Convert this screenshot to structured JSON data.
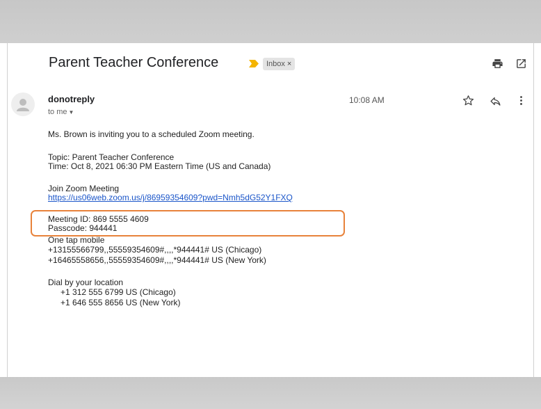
{
  "email": {
    "subject": "Parent Teacher Conference",
    "label_chip": "Inbox",
    "label_chip_close": "×",
    "sender": "donotreply",
    "recipient": "to me",
    "time": "10:08 AM",
    "body": {
      "invite_line": "Ms. Brown is inviting you to a scheduled Zoom meeting.",
      "topic": "Topic: Parent Teacher Conference",
      "time_line": "Time: Oct 8, 2021 06:30 PM Eastern Time (US and Canada)",
      "join_heading": "Join Zoom Meeting",
      "join_link": "https://us06web.zoom.us/j/86959354609?pwd=Nmh5dG52Y1FXQ",
      "meeting_id": "Meeting ID: 869 5555 4609",
      "passcode": "Passcode: 944441",
      "one_tap_heading": "One tap mobile",
      "one_tap_chicago": "+13155566799,,55559354609#,,,,*944441# US (Chicago)",
      "one_tap_newyork": "+16465558656,,55559354609#,,,,*944441# US (New York)",
      "dial_heading": "Dial by your location",
      "dial_chicago": "+1 312 555 6799 US (Chicago)",
      "dial_newyork": "+1 646 555 8656 US (New York)"
    }
  },
  "icons": {
    "print": "print-icon",
    "open_new_window": "open-in-new-window-icon",
    "star": "star-icon",
    "reply": "reply-icon",
    "more": "more-vertical-icon",
    "avatar": "default-avatar-icon",
    "label": "important-label-chevron-icon"
  },
  "colors": {
    "highlight_border": "#e8823a",
    "link": "#1a55c9",
    "label_chevron": "#f4b400",
    "band_gray": "#cbcbcb"
  }
}
